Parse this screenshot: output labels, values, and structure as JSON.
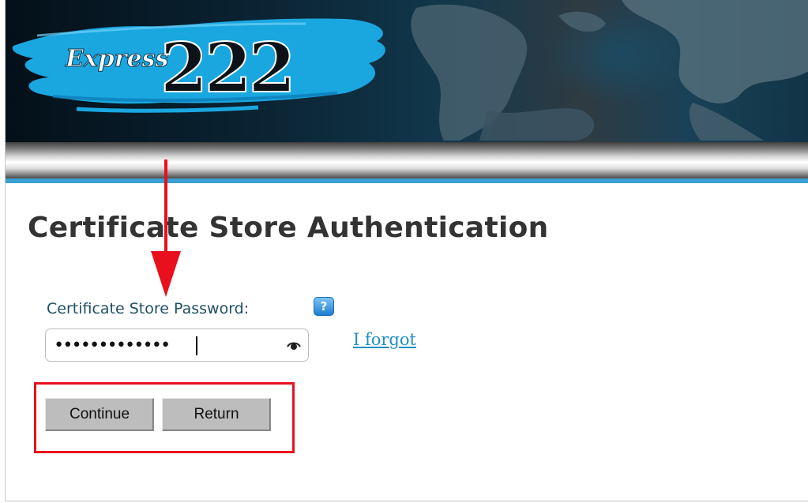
{
  "banner": {
    "brand_word": "Express",
    "brand_number": "222"
  },
  "page": {
    "title": "Certificate Store Authentication"
  },
  "form": {
    "password_label": "Certificate Store Password:",
    "help_symbol": "?",
    "password_value": "•••••••••••••",
    "forgot_link": "I forgot"
  },
  "buttons": {
    "continue_label": "Continue",
    "return_label": "Return"
  },
  "icons": {
    "help": "help-icon",
    "eye": "show-password-icon"
  },
  "annotation": {
    "color": "#e8101c"
  },
  "colors": {
    "accent_blue": "#3b9fd3",
    "link": "#1f8fc4",
    "label": "#1e4f66"
  }
}
